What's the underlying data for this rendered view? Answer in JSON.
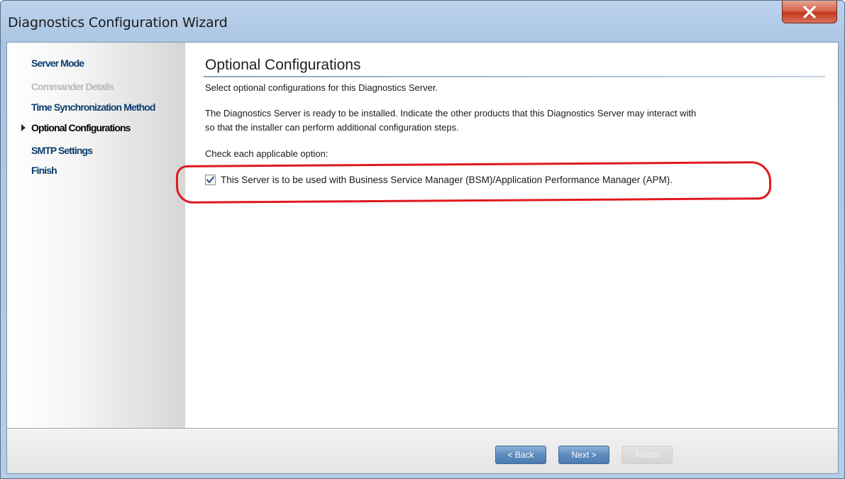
{
  "window": {
    "title": "Diagnostics Configuration Wizard",
    "close_glyph": "X"
  },
  "sidebar": {
    "items": [
      {
        "label": "Server Mode",
        "state": "normal"
      },
      {
        "label": "Commander Details",
        "state": "disabled"
      },
      {
        "label": "Time Synchronization Method",
        "state": "normal"
      },
      {
        "label": "Optional Configurations",
        "state": "current"
      },
      {
        "label": "SMTP Settings",
        "state": "normal"
      },
      {
        "label": "Finish",
        "state": "normal"
      }
    ]
  },
  "main": {
    "title": "Optional Configurations",
    "subtitle": "Select optional configurations for this Diagnostics Server.",
    "description_line1": "The Diagnostics Server is ready to be installed. Indicate the other products that this Diagnostics Server may interact with",
    "description_line2": "so that the installer can perform additional configuration steps.",
    "instruction": "Check each applicable option:",
    "option_bsm": {
      "label": "This Server is to be used with Business Service Manager (BSM)/Application Performance Manager (APM).",
      "checked": true
    }
  },
  "footer": {
    "back_label": "< Back",
    "next_label": "Next >",
    "finish_label": "Finish"
  },
  "colors": {
    "nav_link": "#0c3d6e",
    "highlight": "#e0191e",
    "button": "#5d8cc0"
  },
  "icons": {
    "close": "close-icon",
    "checkbox": "checkmark-icon",
    "current_step": "triangle-right-icon"
  }
}
